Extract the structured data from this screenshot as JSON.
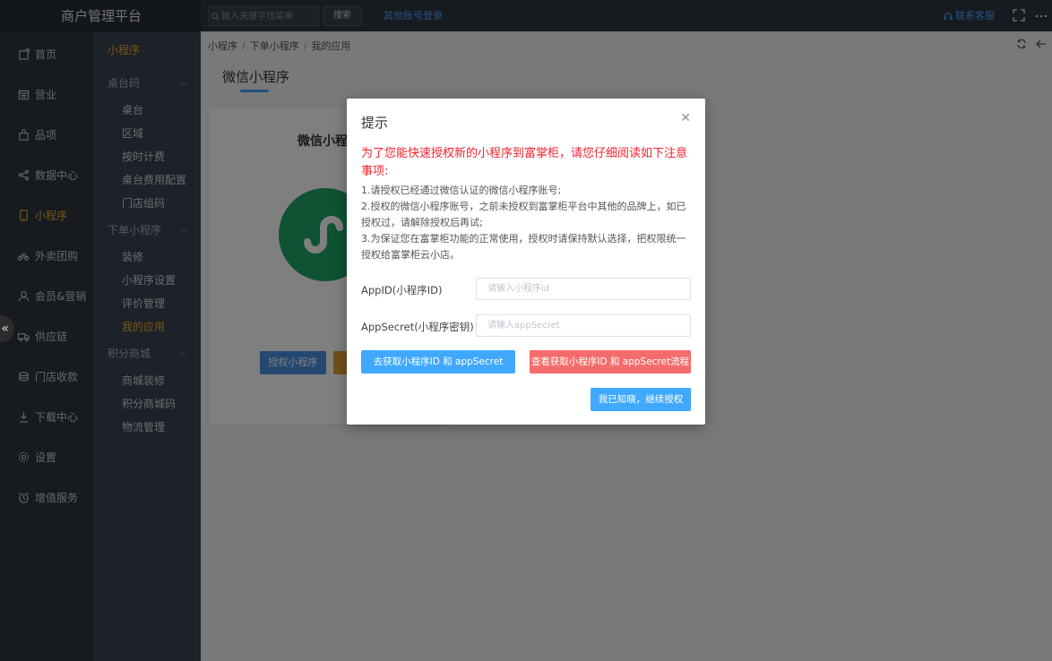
{
  "app": {
    "title": "商户管理平台"
  },
  "topbar": {
    "search_placeholder": "输入关键字找菜单",
    "search_button": "搜索",
    "other_login": "其他账号登录",
    "contact": "联系客服"
  },
  "nav1": {
    "items": [
      {
        "label": "首页",
        "icon": "home-icon"
      },
      {
        "label": "营业",
        "icon": "calendar-icon"
      },
      {
        "label": "品项",
        "icon": "bag-icon"
      },
      {
        "label": "数据中心",
        "icon": "share-icon"
      },
      {
        "label": "小程序",
        "icon": "phone-icon"
      },
      {
        "label": "外卖团购",
        "icon": "bike-icon"
      },
      {
        "label": "会员&营销",
        "icon": "user-icon"
      },
      {
        "label": "供应链",
        "icon": "truck-icon"
      },
      {
        "label": "门店收款",
        "icon": "coin-icon"
      },
      {
        "label": "下载中心",
        "icon": "download-icon"
      },
      {
        "label": "设置",
        "icon": "gear-icon"
      },
      {
        "label": "增值服务",
        "icon": "alarm-icon"
      }
    ]
  },
  "nav2": {
    "head": "小程序",
    "groups": [
      {
        "label": "桌台码",
        "items": [
          "桌台",
          "区域",
          "按时计费",
          "桌台费用配置",
          "门店组码"
        ]
      },
      {
        "label": "下单小程序",
        "items": [
          "装修",
          "小程序设置",
          "评价管理",
          "我的应用"
        ]
      },
      {
        "label": "积分商城",
        "items": [
          "商城装修",
          "积分商城码",
          "物流管理"
        ]
      }
    ]
  },
  "breadcrumb": [
    "小程序",
    "下单小程序",
    "我的应用"
  ],
  "page": {
    "title": "微信小程序",
    "card_title": "微信小程",
    "card_btn1": "授权小程序"
  },
  "dialog": {
    "title": "提示",
    "warning": "为了您能快速授权新的小程序到富掌柜，请您仔细阅读如下注意事项:",
    "notes": [
      "1.请授权已经通过微信认证的微信小程序账号;",
      "2.授权的微信小程序账号，之前未授权到富掌柜平台中其他的品牌上，如已授权过，请解除授权后再试;",
      "3.为保证您在富掌柜功能的正常使用，授权时请保持默认选择，把权限统一授权给富掌柜云小店。"
    ],
    "appid_label": "AppID(小程序ID)",
    "appid_placeholder": "请输入小程序id",
    "secret_label": "AppSecret(小程序密钥)",
    "secret_placeholder": "请输入appSecret",
    "btn_get": "去获取小程序ID 和 appSecret",
    "btn_view": "查看获取小程序ID 和 appSecret流程",
    "btn_ok": "我已知晓，继续授权"
  },
  "colors": {
    "accent": "#40a9ff",
    "warning": "#f5222d",
    "active_nav": "#f0ad2e",
    "nav_bg": "#2f3640"
  }
}
